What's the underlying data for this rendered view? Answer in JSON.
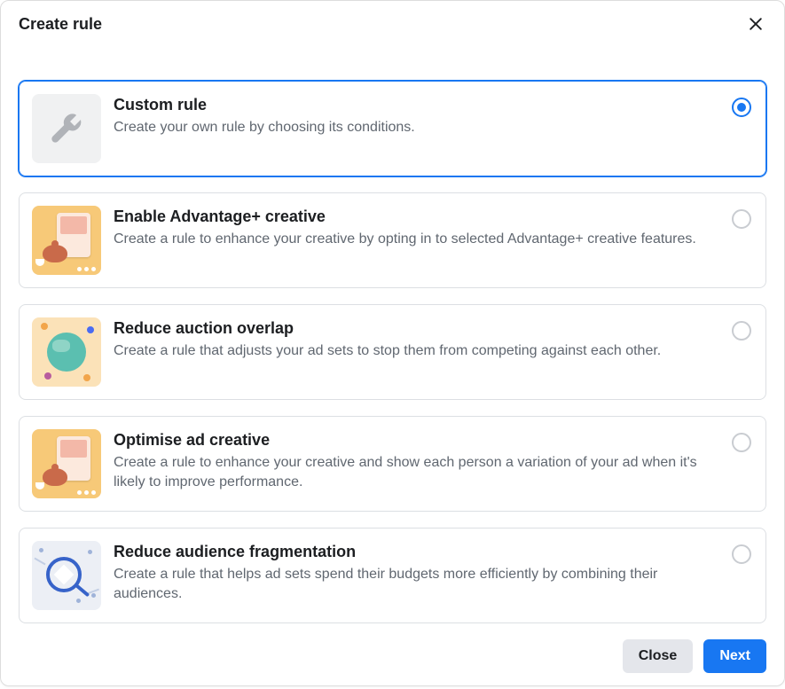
{
  "header": {
    "title": "Create rule"
  },
  "options": [
    {
      "title": "Custom rule",
      "description": "Create your own rule by choosing its conditions.",
      "selected": true,
      "icon": "wrench-icon"
    },
    {
      "title": "Enable Advantage+ creative",
      "description": "Create a rule to enhance your creative by opting in to selected Advantage+ creative features.",
      "selected": false,
      "icon": "creative-card-icon"
    },
    {
      "title": "Reduce auction overlap",
      "description": "Create a rule that adjusts your ad sets to stop them from competing against each other.",
      "selected": false,
      "icon": "globe-icon"
    },
    {
      "title": "Optimise ad creative",
      "description": "Create a rule to enhance your creative and show each person a variation of your ad when it's likely to improve performance.",
      "selected": false,
      "icon": "creative-card-icon"
    },
    {
      "title": "Reduce audience fragmentation",
      "description": "Create a rule that helps ad sets spend their budgets more efficiently by combining their audiences.",
      "selected": false,
      "icon": "magnify-diamond-icon"
    }
  ],
  "footer": {
    "close_label": "Close",
    "next_label": "Next"
  }
}
